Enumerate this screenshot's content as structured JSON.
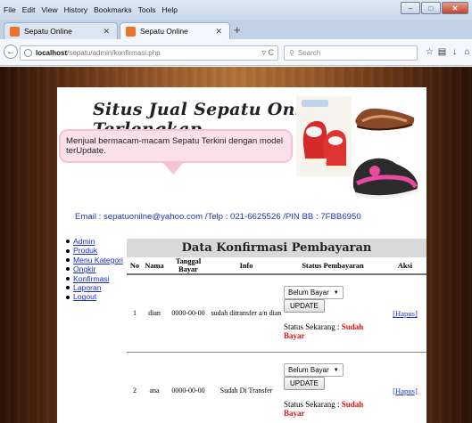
{
  "menubar": [
    "File",
    "Edit",
    "View",
    "History",
    "Bookmarks",
    "Tools",
    "Help"
  ],
  "tabs": [
    {
      "label": "Sepatu Online",
      "active": false
    },
    {
      "label": "Sepatu Online",
      "active": true
    }
  ],
  "url": {
    "host": "localhost",
    "path": "/sepatu/admin/konfirmasi.php"
  },
  "search": {
    "placeholder": "Search"
  },
  "site": {
    "title": "Situs Jual Sepatu Online Terlengkap",
    "tagline": "Menjual bermacam-macam Sepatu Terkini dengan model terUpdate.",
    "contact": "Email : sepatuonilne@yahoo.com /Telp : 021-6625526 /PIN BB : 7FBB6950"
  },
  "sidebar": {
    "items": [
      "Admin",
      "Produk",
      "Menu Kategori",
      "Ongkir",
      "Konfirmasi",
      "Laporan",
      "Logout"
    ]
  },
  "content": {
    "title": "Data Konfirmasi Pembayaran",
    "columns": [
      "No",
      "Nama",
      "Tanggal Bayar",
      "Info",
      "Status Pembayaran",
      "Aksi"
    ],
    "rows": [
      {
        "no": "1",
        "nama": "dian",
        "tanggal": "0000-00-00",
        "info": "sudah ditransfer a/n dian",
        "select": "Belum Bayar",
        "button": "UPDATE",
        "status_label": "Status Sekarang :",
        "status_value": "Sudah Bayar",
        "aksi": "[Hapus]"
      },
      {
        "no": "2",
        "nama": "ana",
        "tanggal": "0000-00-00",
        "info": "Sudah Di Transfer",
        "select": "Belum Bayar",
        "button": "UPDATE",
        "status_label": "Status Sekarang :",
        "status_value": "Sudah Bayar",
        "aksi": "[Hapus]"
      }
    ]
  },
  "colors": {
    "link": "#1a2fd0",
    "status": "#e01010",
    "email": "#1a37b5"
  }
}
